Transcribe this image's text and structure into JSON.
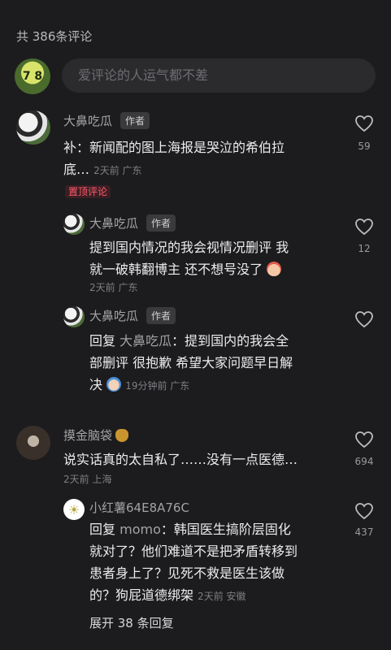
{
  "header": {
    "comment_count": "共 386条评论"
  },
  "composer": {
    "placeholder": "爱评论的人运气都不差",
    "avatar_text": "7 8"
  },
  "comments": [
    {
      "name": "大鼻吃瓜",
      "tag": "作者",
      "line1": "补：新闻配的图上海报是哭泣的希伯拉",
      "line2": "底…",
      "meta": "2天前  广东",
      "pin": "置顶评论",
      "likes": "59"
    },
    {
      "name": "大鼻吃瓜",
      "tag": "作者",
      "line1": "提到国内情况的我会视情况删评 我",
      "line2": "就一破韩翻博主 还不想号没了",
      "meta": "2天前  广东",
      "likes": "12"
    },
    {
      "name": "大鼻吃瓜",
      "tag": "作者",
      "reply_prefix": "回复",
      "mention": "大鼻吃瓜",
      "line1_rest": "：提到国内的我会全",
      "line2": "部删评 很抱歉 希望大家问题早日解",
      "line3": "决",
      "meta": "19分钟前  广东"
    },
    {
      "name": "摸金脑袋",
      "line1": "说实话真的太自私了……没有一点医德…",
      "meta": "2天前  上海",
      "likes": "694"
    },
    {
      "name": "小红薯64E8A76C",
      "reply_prefix": "回复",
      "mention": "momo",
      "line1_rest": "：韩国医生搞阶层固化",
      "line2": "就对了？他们难道不是把矛盾转移到",
      "line3": "患者身上了？见死不救是医生该做",
      "line4": "的？狗屁道德绑架",
      "meta": "2天前  安徽",
      "likes": "437"
    }
  ],
  "expand_label": "展开 38 条回复"
}
